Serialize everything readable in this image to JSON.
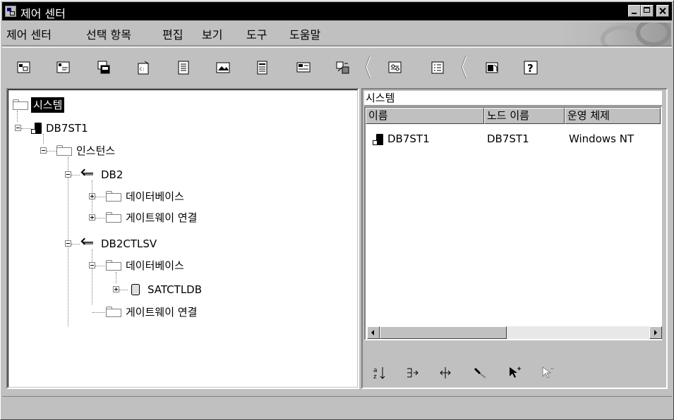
{
  "window": {
    "title": "제어 센터"
  },
  "menu": [
    "제어 센터",
    "선택 항목",
    "편집",
    "보기",
    "도구",
    "도움말"
  ],
  "toolbar": {
    "icons": [
      "systems-view-icon",
      "instances-view-icon",
      "replication-center-icon",
      "command-center-icon",
      "script-center-icon",
      "alert-center-icon",
      "journal-icon",
      "license-center-icon",
      "development-center-icon",
      "tools-settings-icon",
      "task-center-icon",
      "information-center-icon",
      "help-icon"
    ]
  },
  "tree": {
    "root": "시스템",
    "system": "DB7ST1",
    "instances": "인스턴스",
    "inst1": "DB2",
    "inst1_db": "데이터베이스",
    "inst1_gw": "게이트웨이 연결",
    "inst2": "DB2CTLSV",
    "inst2_db": "데이터베이스",
    "inst2_db_item": "SATCTLDB",
    "inst2_gw": "게이트웨이 연결"
  },
  "right": {
    "title": "시스템",
    "columns": [
      "이름",
      "노드 이름",
      "운영 체제"
    ],
    "rows": [
      {
        "name": "DB7ST1",
        "node": "DB7ST1",
        "os": "Windows NT"
      }
    ],
    "bottom_tools": [
      "sort-icon",
      "filter-icon",
      "customize-columns-icon",
      "find-icon",
      "select-all-icon",
      "deselect-all-icon"
    ]
  },
  "status": {
    "text": ""
  }
}
